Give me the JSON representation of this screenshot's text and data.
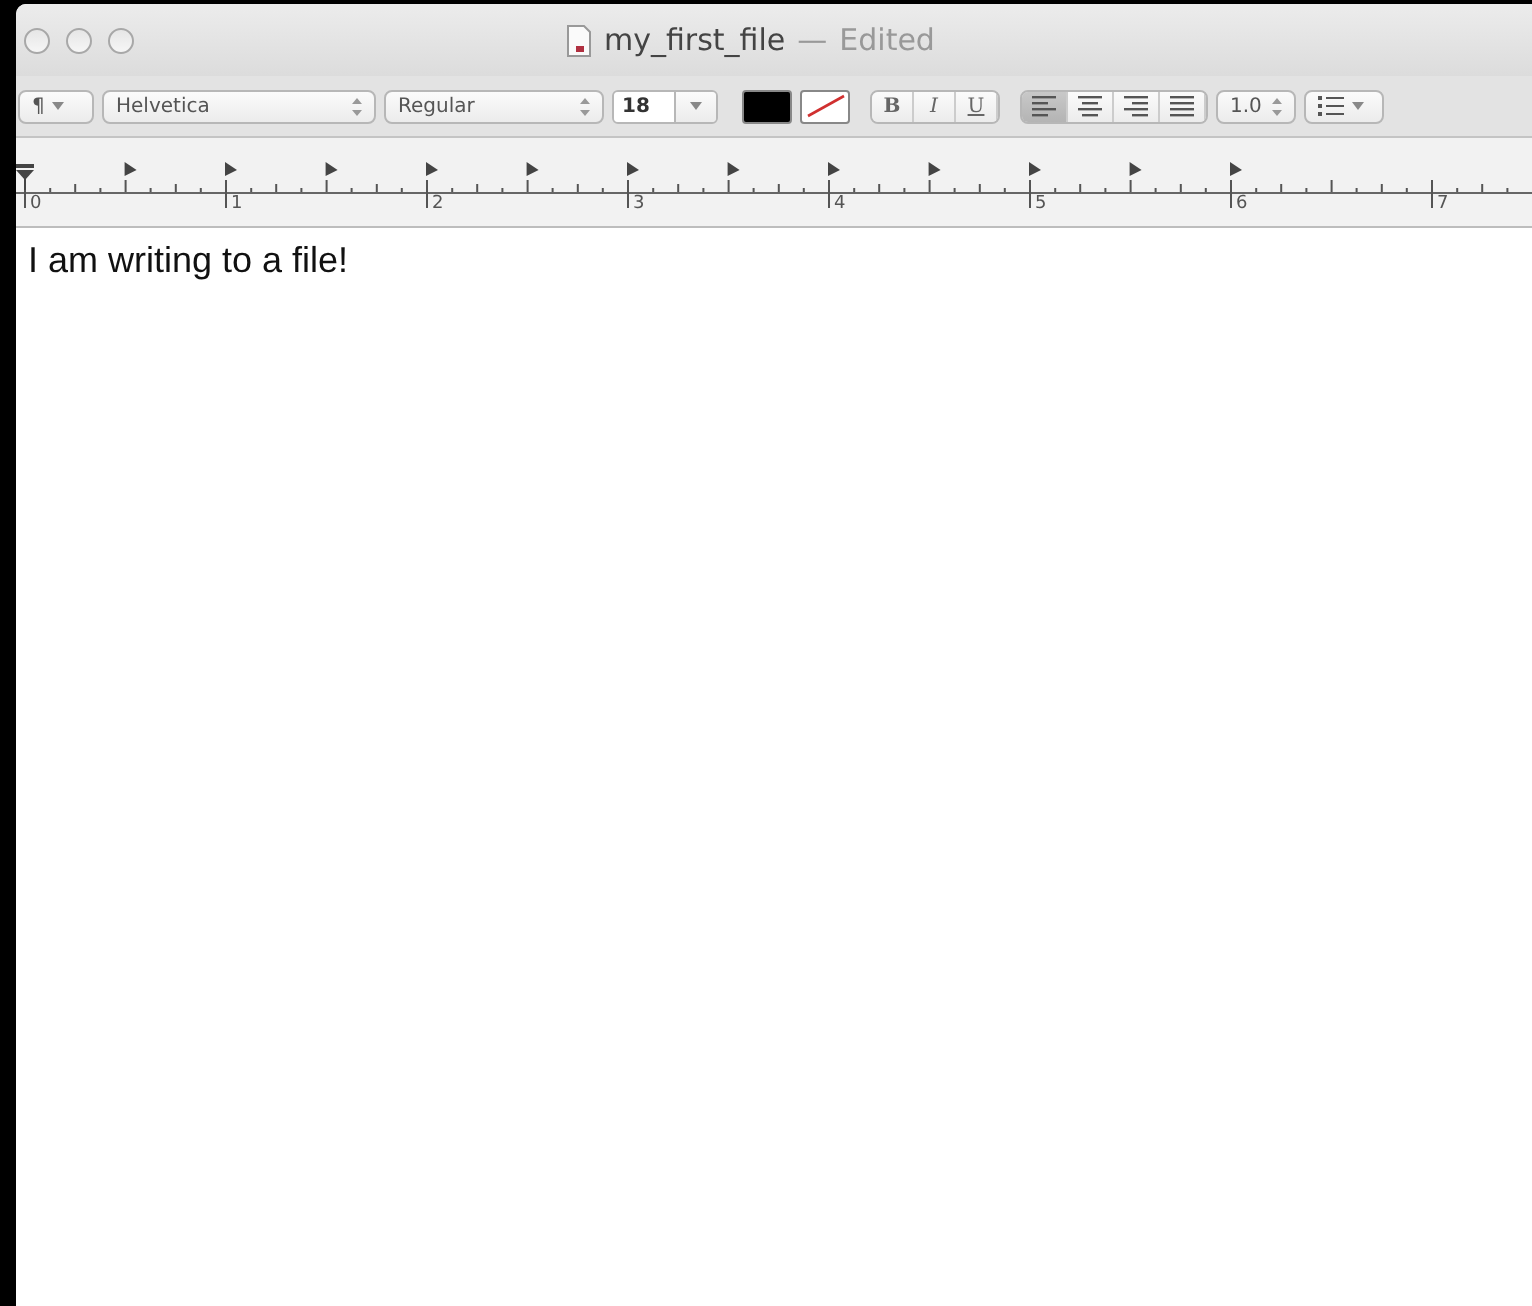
{
  "window": {
    "title": "my_first_file",
    "separator": "—",
    "status": "Edited"
  },
  "toolbar": {
    "paragraph": "¶",
    "font": "Helvetica",
    "typeface": "Regular",
    "size": "18",
    "styles": [
      {
        "kind": "bold",
        "label": "B",
        "selected": false
      },
      {
        "kind": "italic",
        "label": "I",
        "selected": false
      },
      {
        "kind": "underline",
        "label": "U",
        "selected": false
      }
    ],
    "alignments": [
      {
        "kind": "left",
        "selected": true
      },
      {
        "kind": "center",
        "selected": false
      },
      {
        "kind": "right",
        "selected": false
      },
      {
        "kind": "justify",
        "selected": false
      }
    ],
    "spacing": "1.0"
  },
  "ruler": {
    "labels": [
      "0",
      "1",
      "2",
      "3",
      "4",
      "5",
      "6",
      "7"
    ]
  },
  "document": {
    "text": "I am writing to a file!"
  }
}
